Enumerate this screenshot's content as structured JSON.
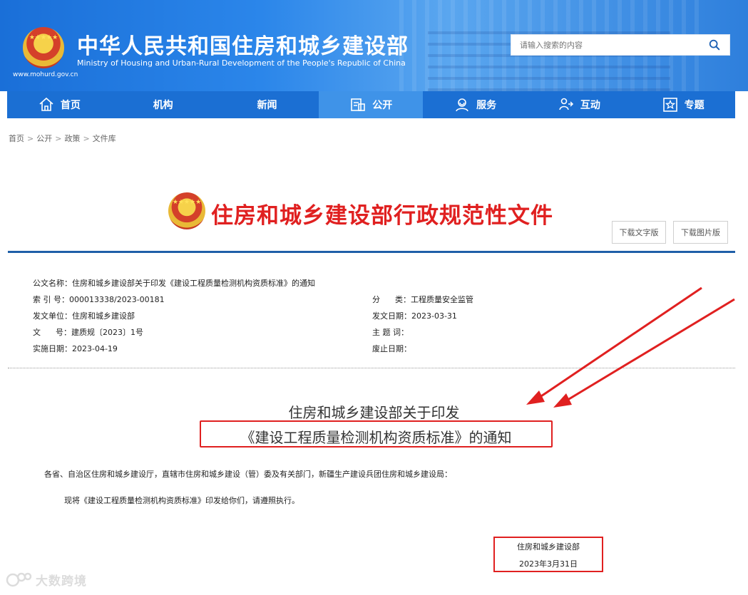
{
  "header": {
    "site_title": "中华人民共和国住房和城乡建设部",
    "site_subtitle": "Ministry of Housing and Urban-Rural Development of the People's Republic of China",
    "site_url": "www.mohurd.gov.cn",
    "search_placeholder": "请输入搜索的内容"
  },
  "nav": {
    "items": [
      {
        "label": "首页",
        "icon": "home-icon"
      },
      {
        "label": "机构",
        "icon": ""
      },
      {
        "label": "新闻",
        "icon": ""
      },
      {
        "label": "公开",
        "icon": "document-icon",
        "active": true
      },
      {
        "label": "服务",
        "icon": "service-icon"
      },
      {
        "label": "互动",
        "icon": "interaction-icon"
      },
      {
        "label": "专题",
        "icon": "star-icon"
      }
    ]
  },
  "breadcrumb": [
    "首页",
    "公开",
    "政策",
    "文件库"
  ],
  "doc_header": {
    "title": "住房和城乡建设部行政规范性文件",
    "download_text": "下载文字版",
    "download_image": "下载图片版"
  },
  "meta": {
    "doc_name_label": "公文名称：",
    "doc_name": "住房和城乡建设部关于印发《建设工程质量检测机构资质标准》的通知",
    "index_label": "索 引 号：",
    "index_value": "000013338/2023-00181",
    "category_label": "分      类：",
    "category_value": "工程质量安全监管",
    "issuer_label": "发文单位：",
    "issuer_value": "住房和城乡建设部",
    "issue_date_label": "发文日期：",
    "issue_date_value": "2023-03-31",
    "doc_no_label": "文      号：",
    "doc_no_value": "建质规〔2023〕1号",
    "subject_label": "主 题 词：",
    "subject_value": "",
    "effective_label": "实施日期：",
    "effective_value": "2023-04-19",
    "abolish_label": "废止日期：",
    "abolish_value": ""
  },
  "article": {
    "title_line1": "住房和城乡建设部关于印发",
    "title_line2": "《建设工程质量检测机构资质标准》的通知",
    "recipients": "各省、自治区住房和城乡建设厅，直辖市住房和城乡建设（管）委及有关部门，新疆生产建设兵团住房和城乡建设局：",
    "notice": "现将《建设工程质量检测机构资质标准》印发给你们，请遵照执行。",
    "sign_org": "住房和城乡建设部",
    "sign_date": "2023年3月31日"
  },
  "watermark": {
    "text": "大数跨境"
  },
  "colors": {
    "header_blue": "#1b6fd3",
    "title_red": "#e02020",
    "rule_blue": "#1f5fa8"
  }
}
